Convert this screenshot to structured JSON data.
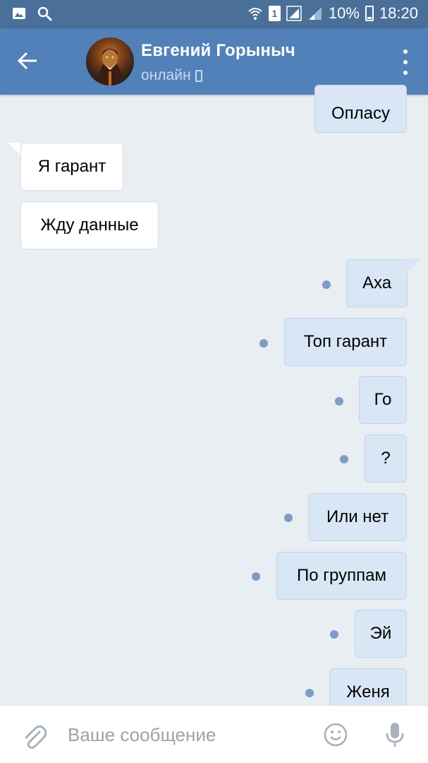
{
  "status_bar": {
    "battery": "10%",
    "time": "18:20",
    "sim_label": "1",
    "icons": [
      "gallery-icon",
      "search-icon",
      "wifi-icon",
      "sim-icon",
      "signal-icon",
      "signal-icon",
      "battery-icon"
    ]
  },
  "header": {
    "contact_name": "Евгений Горыныч",
    "status": "онлайн",
    "icons": [
      "back-arrow-icon",
      "mobile-phone-icon",
      "more-vert-icon"
    ]
  },
  "messages": [
    {
      "direction": "out",
      "text": "Опласу",
      "unread": false
    },
    {
      "direction": "in",
      "text": "Я гарант"
    },
    {
      "direction": "in",
      "text": "Жду данные"
    },
    {
      "direction": "out",
      "text": "Аха",
      "unread": true
    },
    {
      "direction": "out",
      "text": "Топ гарант",
      "unread": true
    },
    {
      "direction": "out",
      "text": "Го",
      "unread": true
    },
    {
      "direction": "out",
      "text": "?",
      "unread": true
    },
    {
      "direction": "out",
      "text": "Или нет",
      "unread": true
    },
    {
      "direction": "out",
      "text": "По группам",
      "unread": true
    },
    {
      "direction": "out",
      "text": "Эй",
      "unread": true
    },
    {
      "direction": "out",
      "text": "Женя",
      "unread": true
    }
  ],
  "composer": {
    "placeholder": "Ваше сообщение",
    "icons": [
      "attach-icon",
      "emoji-icon",
      "microphone-icon"
    ]
  },
  "colors": {
    "status_bar": "#4a6f98",
    "header": "#5181b8",
    "background": "#e9eef3",
    "bubble_out": "#d9e6f5",
    "bubble_in": "#ffffff",
    "unread_dot": "#7d9dc4"
  }
}
